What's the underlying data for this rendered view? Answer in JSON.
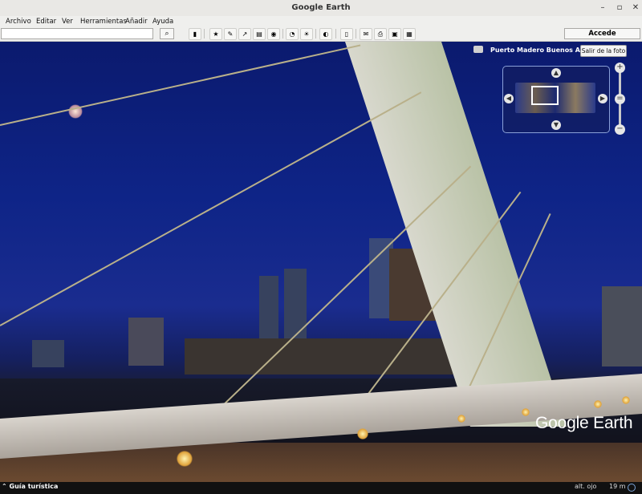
{
  "window": {
    "title": "Google Earth"
  },
  "menu": {
    "items": [
      "Archivo",
      "Editar",
      "Ver",
      "Herramientas",
      "Añadir",
      "Ayuda"
    ]
  },
  "toolbar": {
    "accede_label": "Accede",
    "search_value": ""
  },
  "photo": {
    "location_label": "Puerto Madero Buenos Aires",
    "exit_label": "Salir de la foto"
  },
  "branding": {
    "logo_text": "Google Earth"
  },
  "status": {
    "tour_label": "Guía turística",
    "eye_alt_label": "alt. ojo",
    "eye_alt_value": "19 m"
  }
}
